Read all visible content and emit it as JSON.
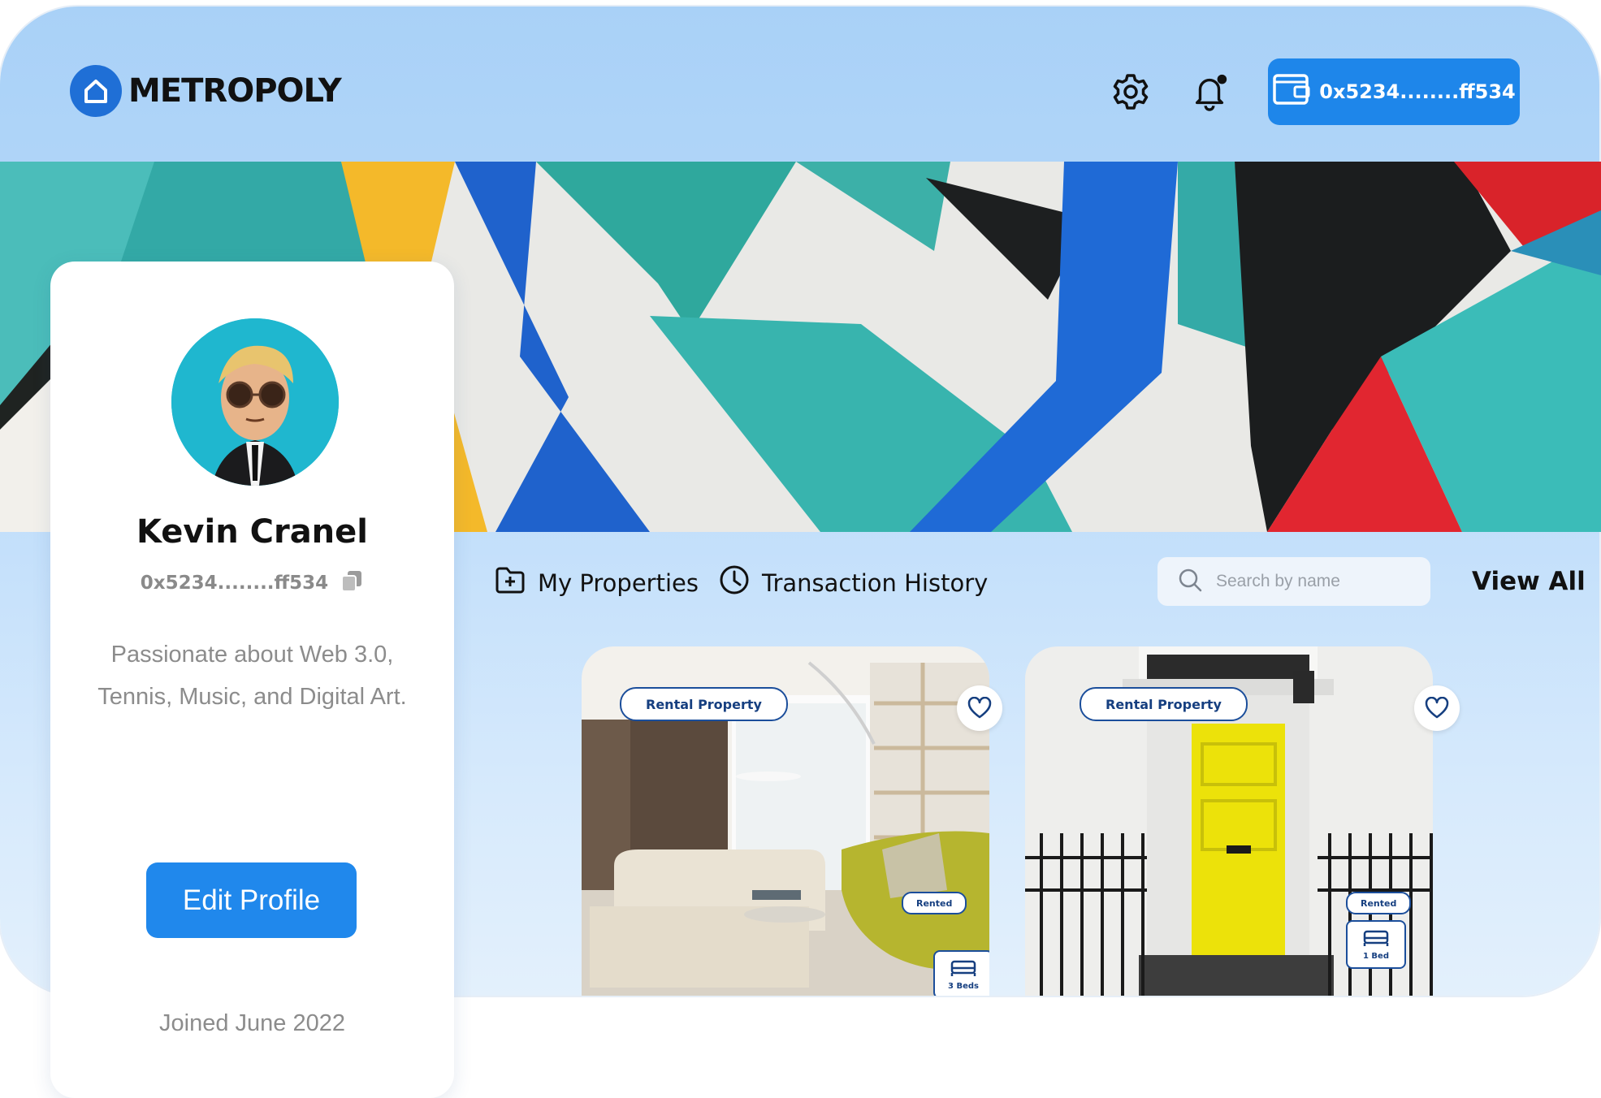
{
  "app": {
    "name": "METROPOLY"
  },
  "header": {
    "wallet_address": "0x5234........ff534"
  },
  "profile": {
    "name": "Kevin Cranel",
    "address": "0x5234........ff534",
    "bio": "Passionate about Web 3.0, Tennis, Music, and Digital Art.",
    "edit_label": "Edit Profile",
    "joined": "Joined June 2022"
  },
  "tabs": [
    {
      "label": "My Properties",
      "icon": "folder-plus-icon"
    },
    {
      "label": "Transaction History",
      "icon": "clock-icon"
    }
  ],
  "search": {
    "placeholder": "Search by name"
  },
  "view_all": "View All",
  "properties": [
    {
      "tag": "Rental Property",
      "status": "Rented",
      "beds": "3 Beds"
    },
    {
      "tag": "Rental Property",
      "status": "Rented",
      "beds": "1 Bed"
    }
  ],
  "colors": {
    "accent": "#1e86ea",
    "brand_dark": "#1b4e9b",
    "background": "#b9dafa"
  }
}
